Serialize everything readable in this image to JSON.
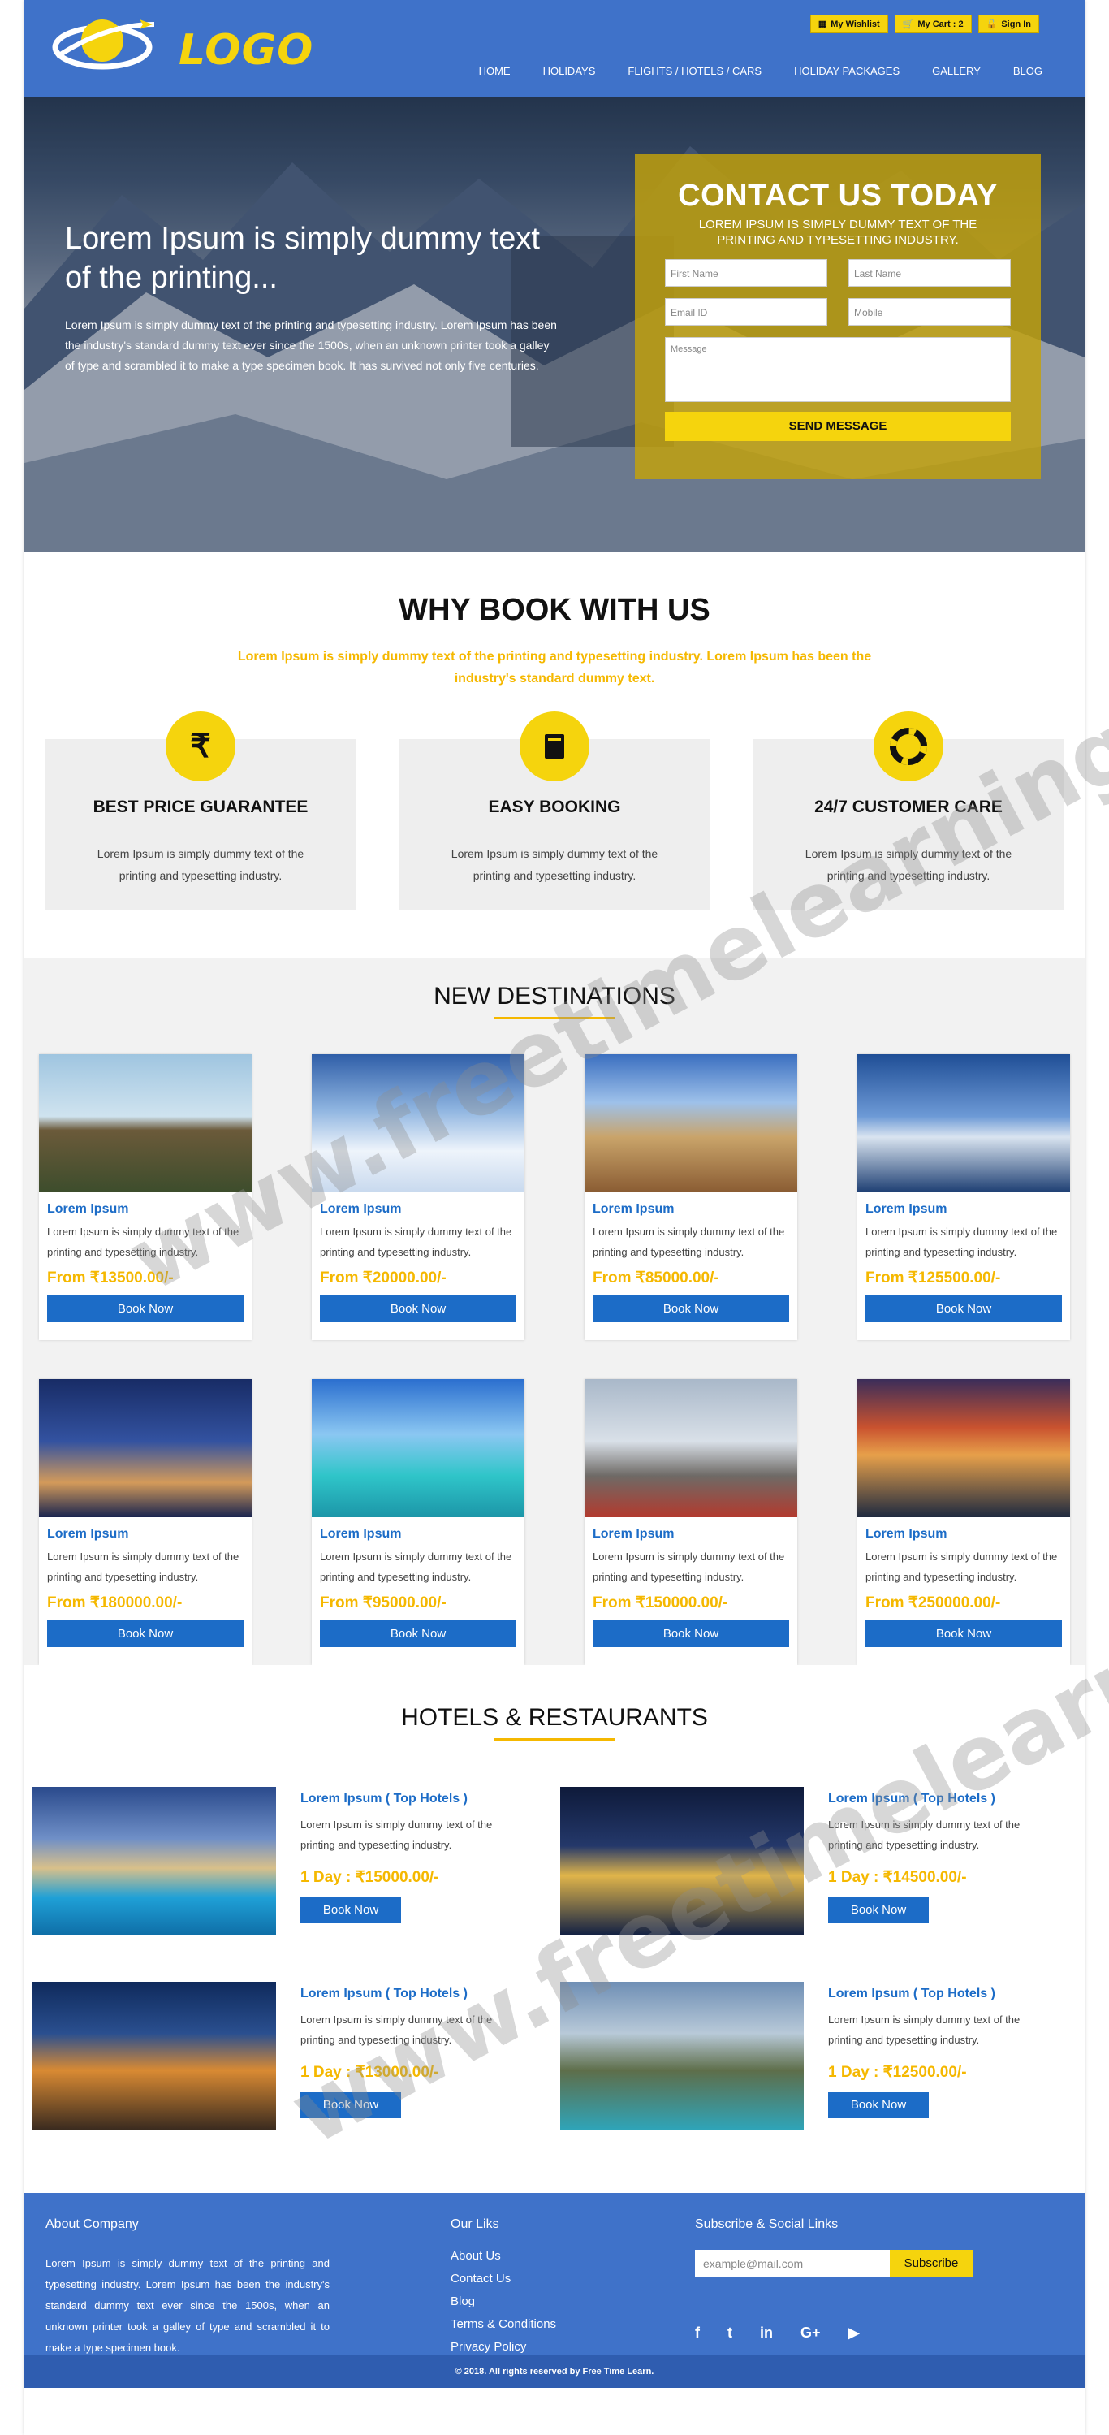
{
  "header": {
    "logo_text": "LOGO",
    "top_buttons": [
      {
        "label": "My Wishlist",
        "icon": "heart-icon"
      },
      {
        "label": "My Cart : 2",
        "icon": "cart-icon"
      },
      {
        "label": "Sign In",
        "icon": "unlock-icon"
      }
    ],
    "nav": [
      "HOME",
      "HOLIDAYS",
      "FLIGHTS / HOTELS / CARS",
      "HOLIDAY PACKAGES",
      "GALLERY",
      "BLOG"
    ]
  },
  "hero": {
    "title": "Lorem Ipsum is simply dummy text of the printing...",
    "text": "Lorem Ipsum is simply dummy text of the printing and typesetting industry. Lorem Ipsum has been the industry's standard dummy text ever since the 1500s, when an unknown printer took a galley of type and scrambled it to make a type specimen book. It has survived not only five centuries."
  },
  "contact": {
    "title": "CONTACT US TODAY",
    "subtitle": "LOREM IPSUM IS SIMPLY DUMMY TEXT OF THE PRINTING AND TYPESETTING INDUSTRY.",
    "first_name_placeholder": "First Name",
    "last_name_placeholder": "Last Name",
    "email_placeholder": "Email ID",
    "mobile_placeholder": "Mobile",
    "message_placeholder": "Message",
    "send_label": "SEND MESSAGE"
  },
  "why": {
    "title": "WHY BOOK WITH US",
    "lead": "Lorem Ipsum is simply dummy text of the printing and typesetting industry. Lorem Ipsum has been the industry's standard dummy text.",
    "features": [
      {
        "icon": "rupee-icon",
        "symbol": "₹",
        "title": "BEST PRICE GUARANTEE",
        "text": "Lorem Ipsum is simply dummy text of the printing and typesetting industry."
      },
      {
        "icon": "book-icon",
        "symbol": "📕",
        "title": "EASY BOOKING",
        "text": "Lorem Ipsum is simply dummy text of the printing and typesetting industry."
      },
      {
        "icon": "lifebuoy-icon",
        "symbol": "◎",
        "title": "24/7 CUSTOMER CARE",
        "text": "Lorem Ipsum is simply dummy text of the printing and typesetting industry."
      }
    ]
  },
  "destinations": {
    "title": "NEW DESTINATIONS",
    "cards": [
      {
        "title": "Lorem Ipsum",
        "text": "Lorem Ipsum is simply dummy text of the printing and typesetting industry.",
        "price": "From ₹13500.00/-",
        "button": "Book Now"
      },
      {
        "title": "Lorem Ipsum",
        "text": "Lorem Ipsum is simply dummy text of the printing and typesetting industry.",
        "price": "From ₹20000.00/-",
        "button": "Book Now"
      },
      {
        "title": "Lorem Ipsum",
        "text": "Lorem Ipsum is simply dummy text of the printing and typesetting industry.",
        "price": "From ₹85000.00/-",
        "button": "Book Now"
      },
      {
        "title": "Lorem Ipsum",
        "text": "Lorem Ipsum is simply dummy text of the printing and typesetting industry.",
        "price": "From ₹125500.00/-",
        "button": "Book Now"
      },
      {
        "title": "Lorem Ipsum",
        "text": "Lorem Ipsum is simply dummy text of the printing and typesetting industry.",
        "price": "From ₹180000.00/-",
        "button": "Book Now"
      },
      {
        "title": "Lorem Ipsum",
        "text": "Lorem Ipsum is simply dummy text of the printing and typesetting industry.",
        "price": "From ₹95000.00/-",
        "button": "Book Now"
      },
      {
        "title": "Lorem Ipsum",
        "text": "Lorem Ipsum is simply dummy text of the printing and typesetting industry.",
        "price": "From ₹150000.00/-",
        "button": "Book Now"
      },
      {
        "title": "Lorem Ipsum",
        "text": "Lorem Ipsum is simply dummy text of the printing and typesetting industry.",
        "price": "From ₹250000.00/-",
        "button": "Book Now"
      }
    ]
  },
  "hotels": {
    "title": "HOTELS & RESTAURANTS",
    "items": [
      {
        "title": "Lorem Ipsum ( Top Hotels )",
        "text": "Lorem Ipsum is simply dummy text of the printing and typesetting industry.",
        "price": "1 Day : ₹15000.00/-",
        "button": "Book Now"
      },
      {
        "title": "Lorem Ipsum ( Top Hotels )",
        "text": "Lorem Ipsum is simply dummy text of the printing and typesetting industry.",
        "price": "1 Day : ₹14500.00/-",
        "button": "Book Now"
      },
      {
        "title": "Lorem Ipsum ( Top Hotels )",
        "text": "Lorem Ipsum is simply dummy text of the printing and typesetting industry.",
        "price": "1 Day : ₹13000.00/-",
        "button": "Book Now"
      },
      {
        "title": "Lorem Ipsum ( Top Hotels )",
        "text": "Lorem Ipsum is simply dummy text of the printing and typesetting industry.",
        "price": "1 Day : ₹12500.00/-",
        "button": "Book Now"
      }
    ]
  },
  "footer": {
    "about_title": "About Company",
    "about_text": "Lorem Ipsum is simply dummy text of the printing and typesetting industry. Lorem Ipsum has been the industry's standard dummy text ever since the 1500s, when an unknown printer took a galley of type and scrambled it to make a type specimen book.",
    "links_title": "Our Liks",
    "links": [
      "About Us",
      "Contact Us",
      "Blog",
      "Terms & Conditions",
      "Privacy Policy"
    ],
    "subscribe_title": "Subscribe & Social Links",
    "subscribe_placeholder": "example@mail.com",
    "subscribe_label": "Subscribe",
    "social": [
      {
        "icon": "facebook-icon",
        "glyph": "f"
      },
      {
        "icon": "twitter-icon",
        "glyph": "t"
      },
      {
        "icon": "linkedin-icon",
        "glyph": "in"
      },
      {
        "icon": "google-plus-icon",
        "glyph": "G+"
      },
      {
        "icon": "youtube-icon",
        "glyph": "▶"
      }
    ],
    "copyright": "© 2018. All rights reserved by Free Time Learn."
  },
  "watermark": "www.freetimelearning.com",
  "colors": {
    "brand_blue": "#3f72c9",
    "accent_yellow": "#f5d40d",
    "link_blue": "#1c6cc7",
    "price_yellow": "#f5b800"
  }
}
